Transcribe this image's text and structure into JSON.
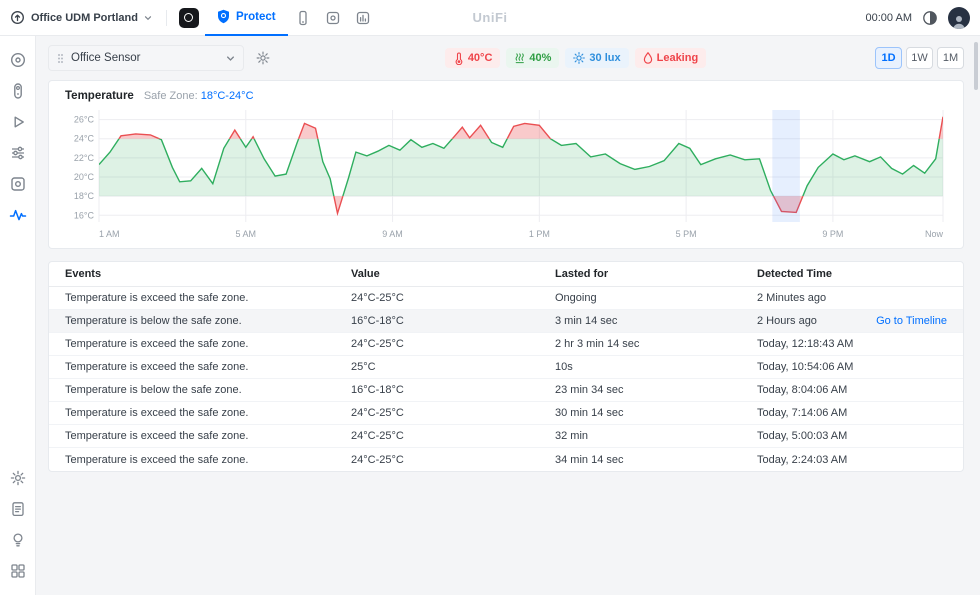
{
  "topbar": {
    "site": {
      "name": "Office UDM Portland"
    },
    "apps": {
      "protect_label": "Protect"
    },
    "brand": "UniFi",
    "clock": "00:00 AM"
  },
  "sidebar": {
    "items": [
      "cameras",
      "doorbells",
      "playback",
      "detections",
      "devices",
      "sensors",
      "settings",
      "system-log",
      "support",
      "apps"
    ],
    "active": "sensors"
  },
  "toolbar": {
    "sensor_select": {
      "value": "Office Sensor"
    },
    "status_badges": [
      {
        "name": "temperature",
        "icon": "thermometer-icon",
        "label": "40°C",
        "color": "#ef444a",
        "bg": "#fdecec"
      },
      {
        "name": "humidity",
        "icon": "humidity-icon",
        "label": "40%",
        "color": "#2f9e44",
        "bg": "#eaf6ef"
      },
      {
        "name": "light",
        "icon": "sun-icon",
        "label": "30 lux",
        "color": "#2f8fdd",
        "bg": "#eaf3fc"
      },
      {
        "name": "leak",
        "icon": "drop-icon",
        "label": "Leaking",
        "color": "#ef444a",
        "bg": "#fdecec"
      }
    ],
    "time_ranges": [
      {
        "label": "1D",
        "active": true
      },
      {
        "label": "1W",
        "active": false
      },
      {
        "label": "1M",
        "active": false
      }
    ]
  },
  "chart": {
    "title": "Temperature",
    "safe_zone_label": "Safe Zone:",
    "safe_zone_value": "18°C-24°C"
  },
  "chart_data": {
    "type": "line",
    "title": "Temperature over 1 day",
    "x_unit": "hour of day (1 = 1 AM, 24 = now/midnight)",
    "x": [
      1,
      1.3,
      1.6,
      2,
      2.4,
      2.7,
      3,
      3.2,
      3.5,
      3.8,
      4.1,
      4.4,
      4.7,
      5,
      5.2,
      5.5,
      5.8,
      6.1,
      6.4,
      6.6,
      6.9,
      7.1,
      7.3,
      7.5,
      7.8,
      8,
      8.3,
      8.6,
      8.9,
      9.2,
      9.5,
      9.8,
      10.1,
      10.4,
      10.7,
      10.9,
      11.1,
      11.4,
      11.7,
      12,
      12.3,
      12.6,
      13,
      13.3,
      13.6,
      14,
      14.4,
      14.8,
      15.2,
      15.6,
      16,
      16.4,
      16.8,
      17.1,
      17.4,
      17.8,
      18.2,
      18.6,
      19,
      19.3,
      19.6,
      20,
      20.3,
      20.6,
      21,
      21.3,
      21.6,
      22,
      22.3,
      22.6,
      22.9,
      23.2,
      23.5,
      23.8,
      24
    ],
    "y": [
      21.3,
      22.6,
      24.3,
      24.5,
      24.4,
      23.9,
      21,
      19.5,
      19.6,
      20.9,
      19.3,
      23,
      24.9,
      23.1,
      24.2,
      21.9,
      20.1,
      20.3,
      23.6,
      25.6,
      25.1,
      21.6,
      19.8,
      16.2,
      19.9,
      22.6,
      22.2,
      22.7,
      23.3,
      22.8,
      23.9,
      23.1,
      23.5,
      23,
      24.3,
      25.2,
      24.1,
      25.4,
      23.6,
      23.1,
      25.3,
      25.6,
      25.4,
      24,
      23.3,
      23.5,
      22.1,
      22.4,
      21.4,
      20.8,
      21.1,
      21.7,
      23.5,
      23,
      21.3,
      21.9,
      22.3,
      21.8,
      21.9,
      18.6,
      16.4,
      16.3,
      19.1,
      21,
      22.4,
      21.8,
      22.2,
      21.6,
      22.1,
      20.9,
      20.3,
      21.2,
      20.4,
      21.9,
      26.3
    ],
    "xlim": [
      1,
      24
    ],
    "ylim": [
      15.3,
      27
    ],
    "y_ticks": [
      26,
      24,
      22,
      20,
      18,
      16
    ],
    "y_tick_labels": [
      "26°C",
      "24°C",
      "22°C",
      "20°C",
      "18°C",
      "16°C"
    ],
    "x_ticks": [
      1,
      5,
      9,
      13,
      17,
      21,
      24
    ],
    "x_tick_labels": [
      "1 AM",
      "5 AM",
      "9 AM",
      "1 PM",
      "5 PM",
      "9 PM",
      "Now"
    ],
    "safe_zone": [
      18,
      24
    ],
    "highlight_band_x": [
      19.35,
      20.1
    ],
    "grid": true,
    "legend": false,
    "colors": {
      "in_zone_line": "#2fae5f",
      "out_zone_line": "#ea4f52",
      "in_zone_fill": "rgba(47,174,95,0.16)",
      "out_zone_fill": "rgba(234,79,82,0.30)",
      "highlight_band": "rgba(59,130,246,0.13)",
      "grid": "#ededf1",
      "tick_text": "#9aa2ab"
    }
  },
  "events_table": {
    "columns": [
      "Events",
      "Value",
      "Lasted for",
      "Detected Time"
    ],
    "timeline_link_label": "Go to Timeline",
    "rows": [
      {
        "event": "Temperature is exceed the safe zone.",
        "value": "24°C-25°C",
        "lasted_for": "Ongoing",
        "detected_time": "2 Minutes ago",
        "link": false,
        "highlighted": false
      },
      {
        "event": "Temperature is below the safe zone.",
        "value": "16°C-18°C",
        "lasted_for": "3 min 14 sec",
        "detected_time": "2 Hours ago",
        "link": true,
        "highlighted": true
      },
      {
        "event": "Temperature is exceed the safe zone.",
        "value": "24°C-25°C",
        "lasted_for": "2 hr 3 min 14 sec",
        "detected_time": "Today, 12:18:43 AM",
        "link": false,
        "highlighted": false
      },
      {
        "event": "Temperature is exceed the safe zone.",
        "value": "25°C",
        "lasted_for": "10s",
        "detected_time": "Today, 10:54:06 AM",
        "link": false,
        "highlighted": false
      },
      {
        "event": "Temperature is below the safe zone.",
        "value": "16°C-18°C",
        "lasted_for": "23 min 34 sec",
        "detected_time": "Today, 8:04:06 AM",
        "link": false,
        "highlighted": false
      },
      {
        "event": "Temperature is exceed the safe zone.",
        "value": "24°C-25°C",
        "lasted_for": "30 min 14 sec",
        "detected_time": "Today, 7:14:06 AM",
        "link": false,
        "highlighted": false
      },
      {
        "event": "Temperature is exceed the safe zone.",
        "value": "24°C-25°C",
        "lasted_for": "32 min",
        "detected_time": "Today, 5:00:03 AM",
        "link": false,
        "highlighted": false
      },
      {
        "event": "Temperature is exceed the safe zone.",
        "value": "24°C-25°C",
        "lasted_for": "34 min 14 sec",
        "detected_time": "Today, 2:24:03 AM",
        "link": false,
        "highlighted": false
      }
    ]
  }
}
